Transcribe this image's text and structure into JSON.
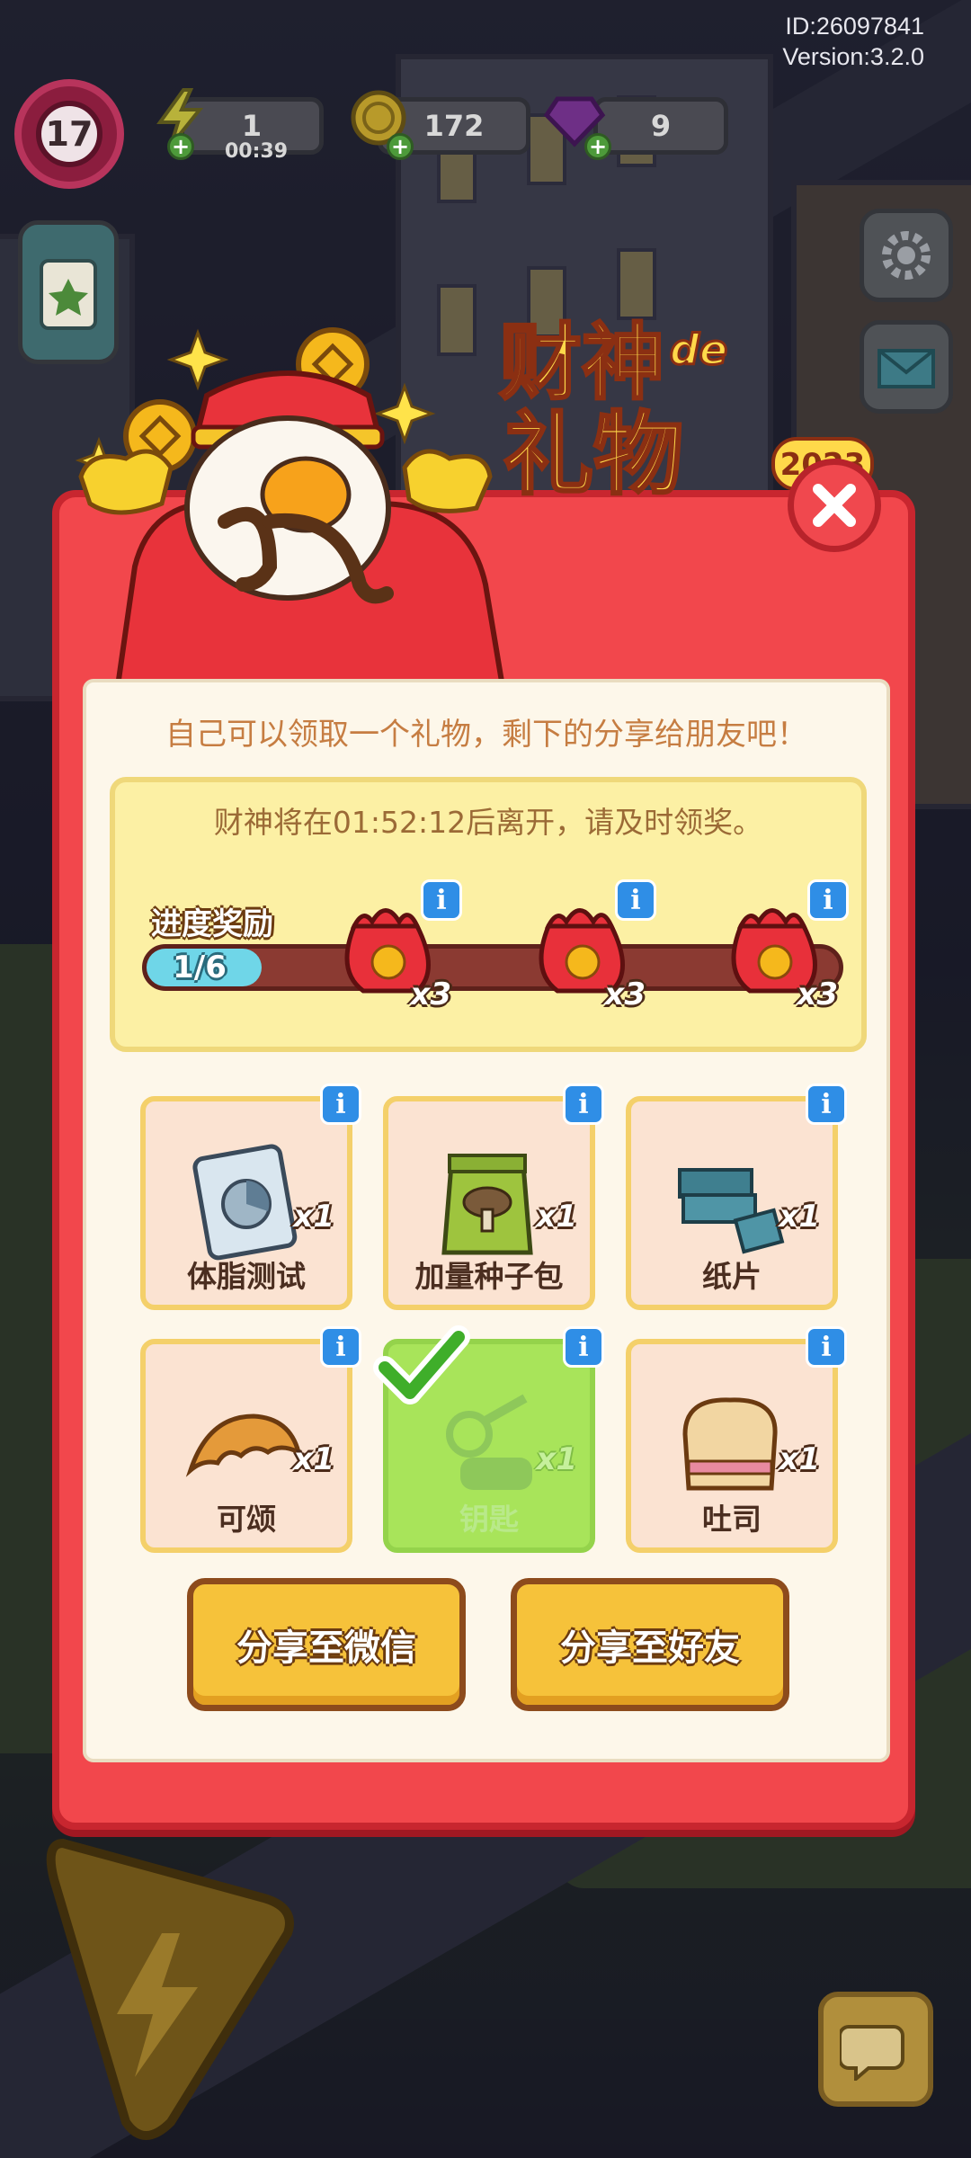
{
  "hud": {
    "id_text": "ID:26097841",
    "version_text": "Version:3.2.0",
    "level": "17",
    "energy": "1",
    "energy_timer": "00:39",
    "coins": "172",
    "gems": "9"
  },
  "modal": {
    "subtitle": "自己可以领取一个礼物，剩下的分享给朋友吧！",
    "countdown": "财神将在01:52:12后离开，请及时领奖。",
    "progress": {
      "caption": "进度奖励",
      "count": "1/6",
      "fraction": 0.1667,
      "rewards": [
        {
          "qty": "x3"
        },
        {
          "qty": "x3"
        },
        {
          "qty": "x3"
        }
      ]
    },
    "items": [
      {
        "name": "体脂测试",
        "qty": "x1"
      },
      {
        "name": "加量种子包",
        "qty": "x1"
      },
      {
        "name": "纸片",
        "qty": "x1"
      },
      {
        "name": "可颂",
        "qty": "x1"
      },
      {
        "name": "钥匙",
        "qty": "x1"
      },
      {
        "name": "吐司",
        "qty": "x1"
      }
    ],
    "share_wechat": "分享至微信",
    "share_friends": "分享至好友"
  },
  "colors": {
    "modal_red": "#f2474c",
    "panel_cream": "#fdf7ea",
    "button_yellow": "#f6c23a",
    "selected_green": "#a8e45a",
    "info_blue": "#2f8ee6"
  }
}
